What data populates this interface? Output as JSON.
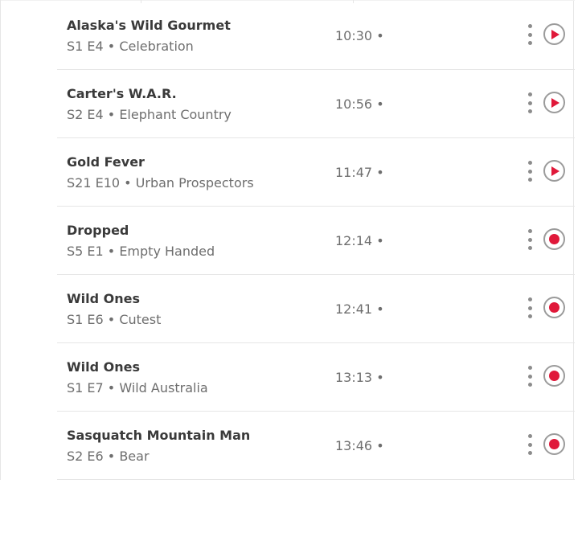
{
  "schedule": {
    "items": [
      {
        "title": "Alaska's Wild Gourmet",
        "episode": "S1 E4 • Celebration",
        "time": "10:30 •",
        "action_icon": "play-icon"
      },
      {
        "title": "Carter's W.A.R.",
        "episode": "S2 E4 • Elephant Country",
        "time": "10:56 •",
        "action_icon": "play-icon"
      },
      {
        "title": "Gold Fever",
        "episode": "S21 E10 • Urban Prospectors",
        "time": "11:47 •",
        "action_icon": "play-icon"
      },
      {
        "title": "Dropped",
        "episode": "S5 E1 • Empty Handed",
        "time": "12:14 •",
        "action_icon": "record-icon"
      },
      {
        "title": "Wild Ones",
        "episode": "S1 E6 • Cutest",
        "time": "12:41 •",
        "action_icon": "record-icon"
      },
      {
        "title": "Wild Ones",
        "episode": "S1 E7 • Wild Australia",
        "time": "13:13 •",
        "action_icon": "record-icon"
      },
      {
        "title": "Sasquatch Mountain Man",
        "episode": "S2 E6 • Bear",
        "time": "13:46 •",
        "action_icon": "record-icon"
      }
    ]
  },
  "colors": {
    "accent": "#e0193a",
    "title_text": "#3a3a3a",
    "secondary_text": "#6e6e6e",
    "divider": "#e6e6e6"
  }
}
